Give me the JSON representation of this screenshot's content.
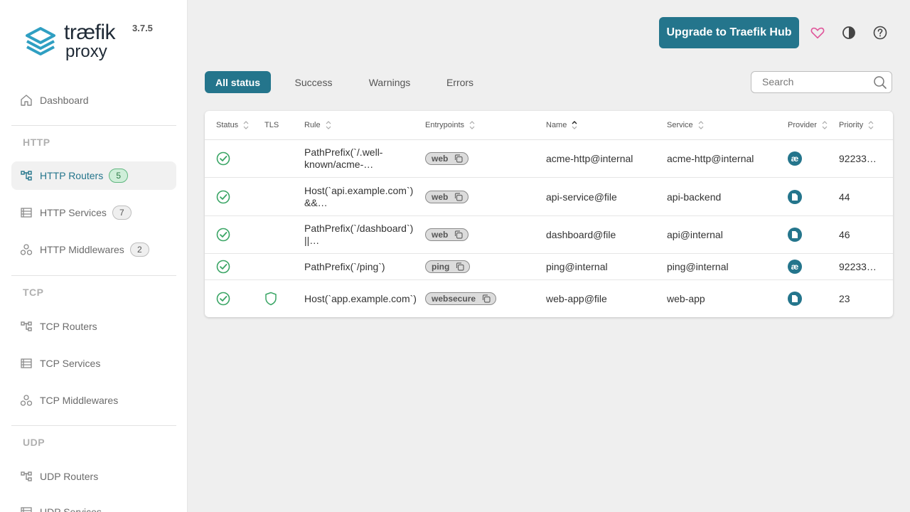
{
  "app": {
    "logo_line1": "træfik",
    "logo_line2": "proxy",
    "version": "3.7.5"
  },
  "sidebar": {
    "dashboard": "Dashboard",
    "sections": [
      {
        "title": "HTTP",
        "items": [
          {
            "label": "HTTP Routers",
            "badge": "5",
            "icon": "routers-icon",
            "active": true
          },
          {
            "label": "HTTP Services",
            "badge": "7",
            "icon": "services-icon"
          },
          {
            "label": "HTTP Middlewares",
            "badge": "2",
            "icon": "middlewares-icon"
          }
        ]
      },
      {
        "title": "TCP",
        "items": [
          {
            "label": "TCP Routers",
            "icon": "routers-icon"
          },
          {
            "label": "TCP Services",
            "icon": "services-icon"
          },
          {
            "label": "TCP Middlewares",
            "icon": "middlewares-icon"
          }
        ]
      },
      {
        "title": "UDP",
        "items": [
          {
            "label": "UDP Routers",
            "icon": "routers-icon"
          },
          {
            "label": "UDP Services",
            "icon": "services-icon"
          }
        ]
      }
    ]
  },
  "header": {
    "upgrade_label": "Upgrade to Traefik Hub",
    "icons": [
      "heart-icon",
      "theme-toggle-icon",
      "help-icon"
    ]
  },
  "filters": {
    "tabs": [
      "All status",
      "Success",
      "Warnings",
      "Errors"
    ],
    "active": "All status",
    "search_placeholder": "Search"
  },
  "table": {
    "columns": [
      "Status",
      "TLS",
      "Rule",
      "Entrypoints",
      "Name",
      "Service",
      "Provider",
      "Priority"
    ],
    "sorted_by": "Name",
    "rows": [
      {
        "status": "success",
        "tls": false,
        "rule": "PathPrefix(`/.well-known/acme-…",
        "entrypoint": "web",
        "name": "acme-http@internal",
        "service": "acme-http@internal",
        "provider": "internal",
        "priority": "92233…"
      },
      {
        "status": "success",
        "tls": false,
        "rule": "Host(`api.example.com`) &&…",
        "entrypoint": "web",
        "name": "api-service@file",
        "service": "api-backend",
        "provider": "file",
        "priority": "44"
      },
      {
        "status": "success",
        "tls": false,
        "rule": "PathPrefix(`/dashboard`) ||…",
        "entrypoint": "web",
        "name": "dashboard@file",
        "service": "api@internal",
        "provider": "file",
        "priority": "46"
      },
      {
        "status": "success",
        "tls": false,
        "rule": "PathPrefix(`/ping`)",
        "entrypoint": "ping",
        "name": "ping@internal",
        "service": "ping@internal",
        "provider": "internal",
        "priority": "92233…"
      },
      {
        "status": "success",
        "tls": true,
        "rule": "Host(`app.example.com`)",
        "entrypoint": "websecure",
        "name": "web-app@file",
        "service": "web-app",
        "provider": "file",
        "priority": "23"
      }
    ]
  },
  "colors": {
    "accent": "#24758c",
    "success": "#3aa565",
    "heart": "#e0569a"
  }
}
